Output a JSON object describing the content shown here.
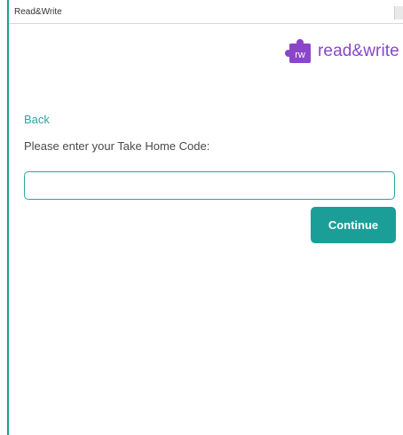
{
  "window": {
    "title": "Read&Write"
  },
  "logo": {
    "mark_text": "rw",
    "text": "read&write",
    "color": "#8a45c9"
  },
  "form": {
    "back_label": "Back",
    "prompt": "Please enter your Take Home Code:",
    "code_value": "",
    "code_placeholder": "",
    "continue_label": "Continue"
  },
  "colors": {
    "accent": "#1c9e98",
    "link": "#2aa7a0",
    "brand_purple": "#8a45c9"
  }
}
